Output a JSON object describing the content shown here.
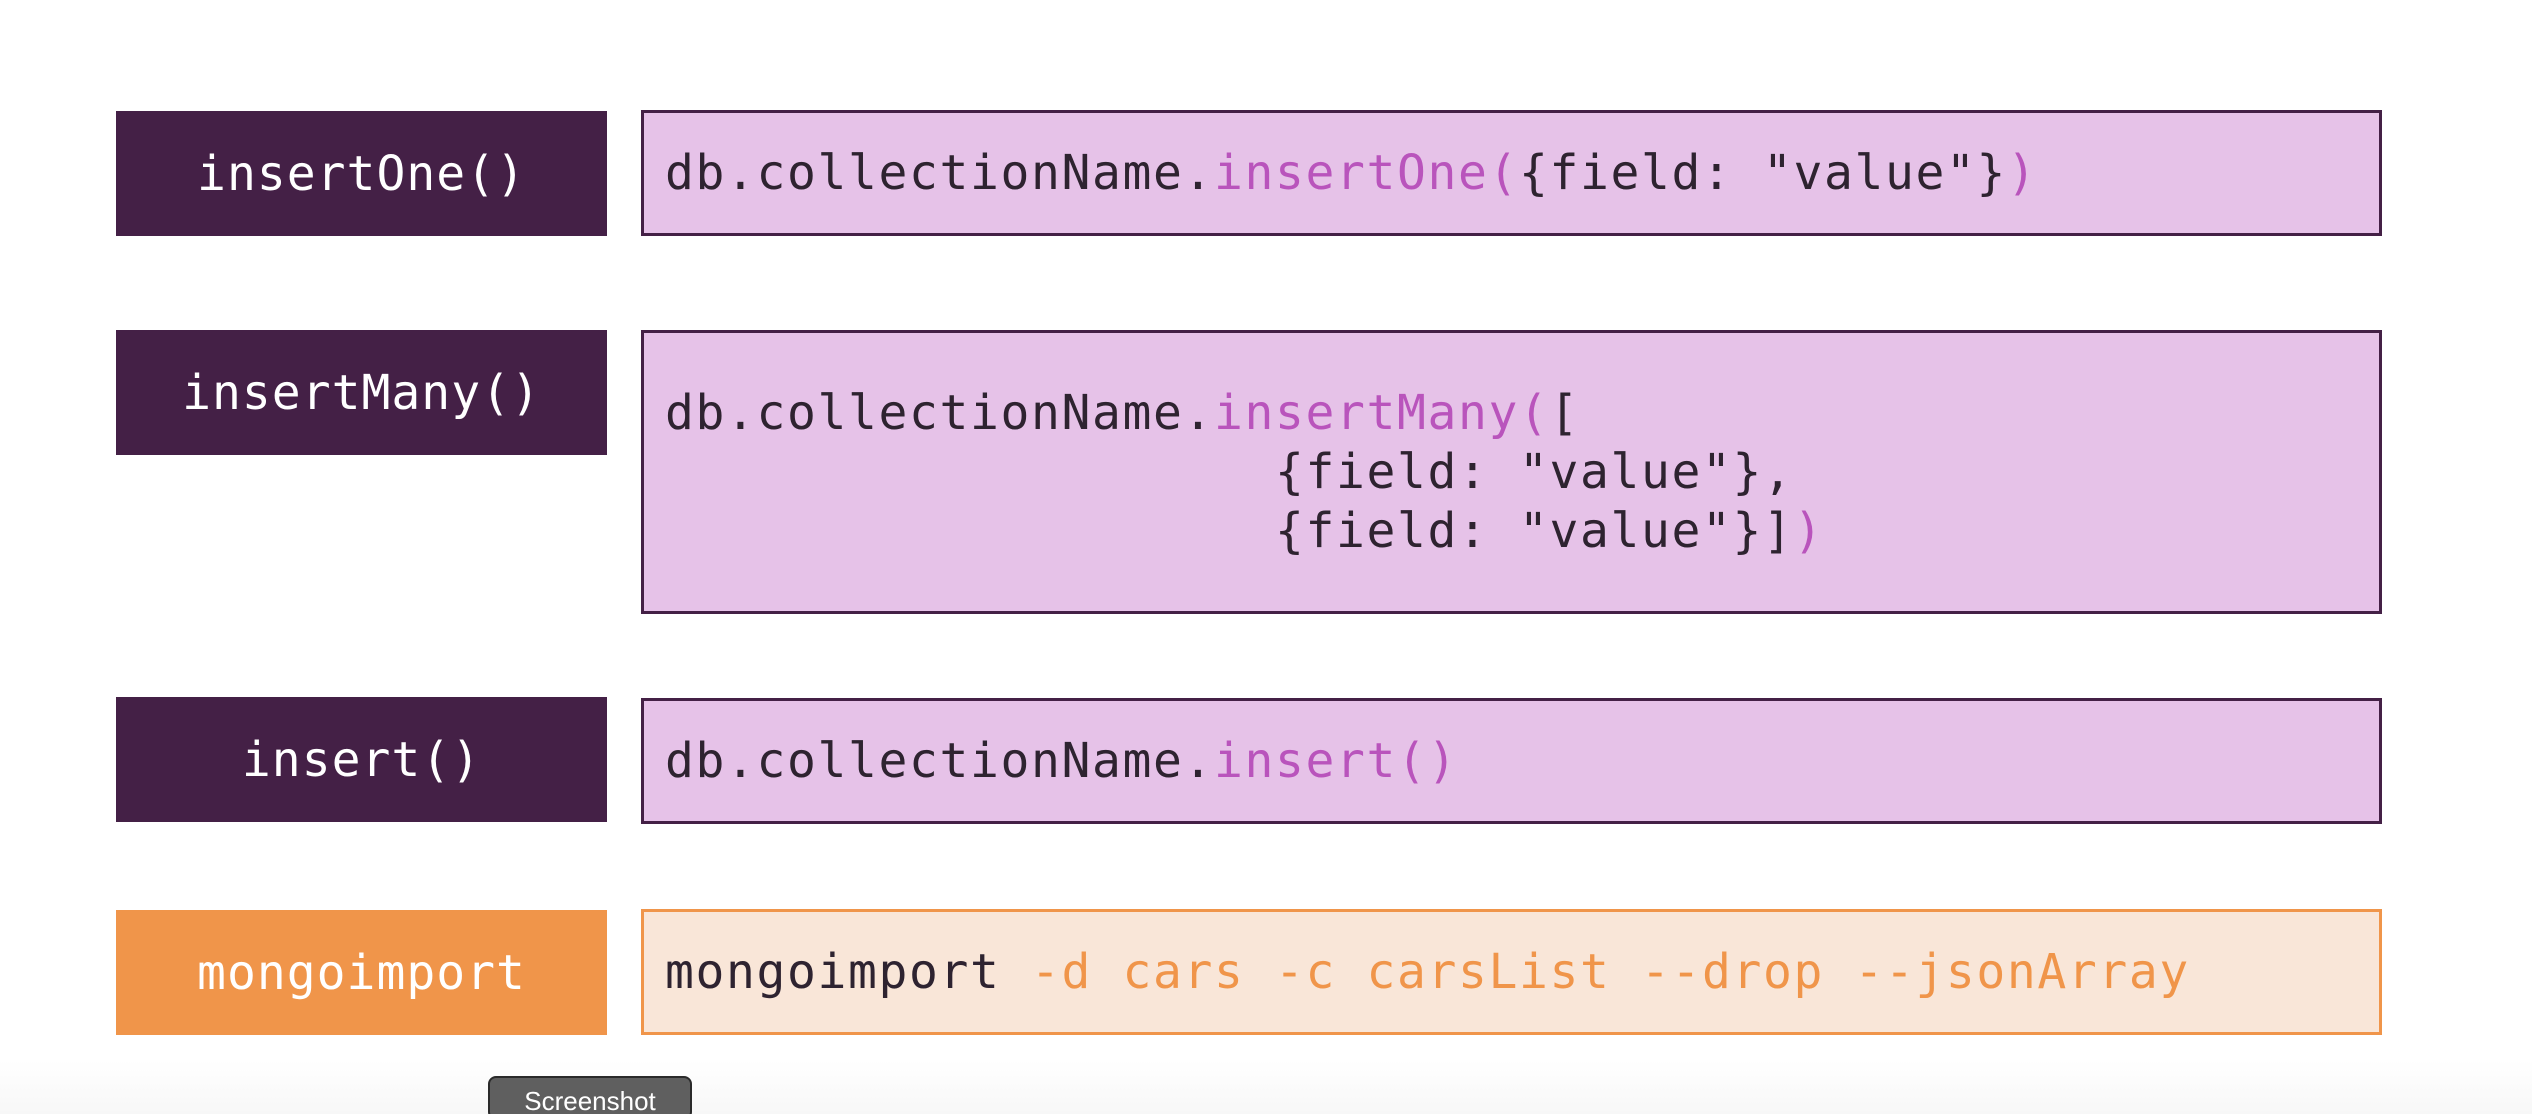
{
  "rows": [
    {
      "label": "insertOne()",
      "code": {
        "prefix": "db.collectionName.",
        "method": "insertOne(",
        "args": "{field: \"value\"}",
        "close": ")"
      }
    },
    {
      "label": "insertMany()",
      "code": {
        "prefix": "db.collectionName.",
        "method": "insertMany(",
        "line1_tail": "[",
        "line2": "                    {field: \"value\"},",
        "line3": "                    {field: \"value\"}]",
        "close": ")"
      }
    },
    {
      "label": "insert()",
      "code": {
        "prefix": "db.collectionName.",
        "method": "insert()"
      }
    },
    {
      "label": "mongoimport",
      "code": {
        "command": "mongoimport ",
        "flags": "-d cars -c carsList --drop --jsonArray"
      }
    }
  ],
  "tooltip": "Screenshot",
  "colors": {
    "label_purple": "#442046",
    "label_orange": "#f0954a",
    "code_purple_bg": "#e6c2e8",
    "code_orange_bg": "#f9e6d8",
    "method_highlight": "#b954bc"
  }
}
